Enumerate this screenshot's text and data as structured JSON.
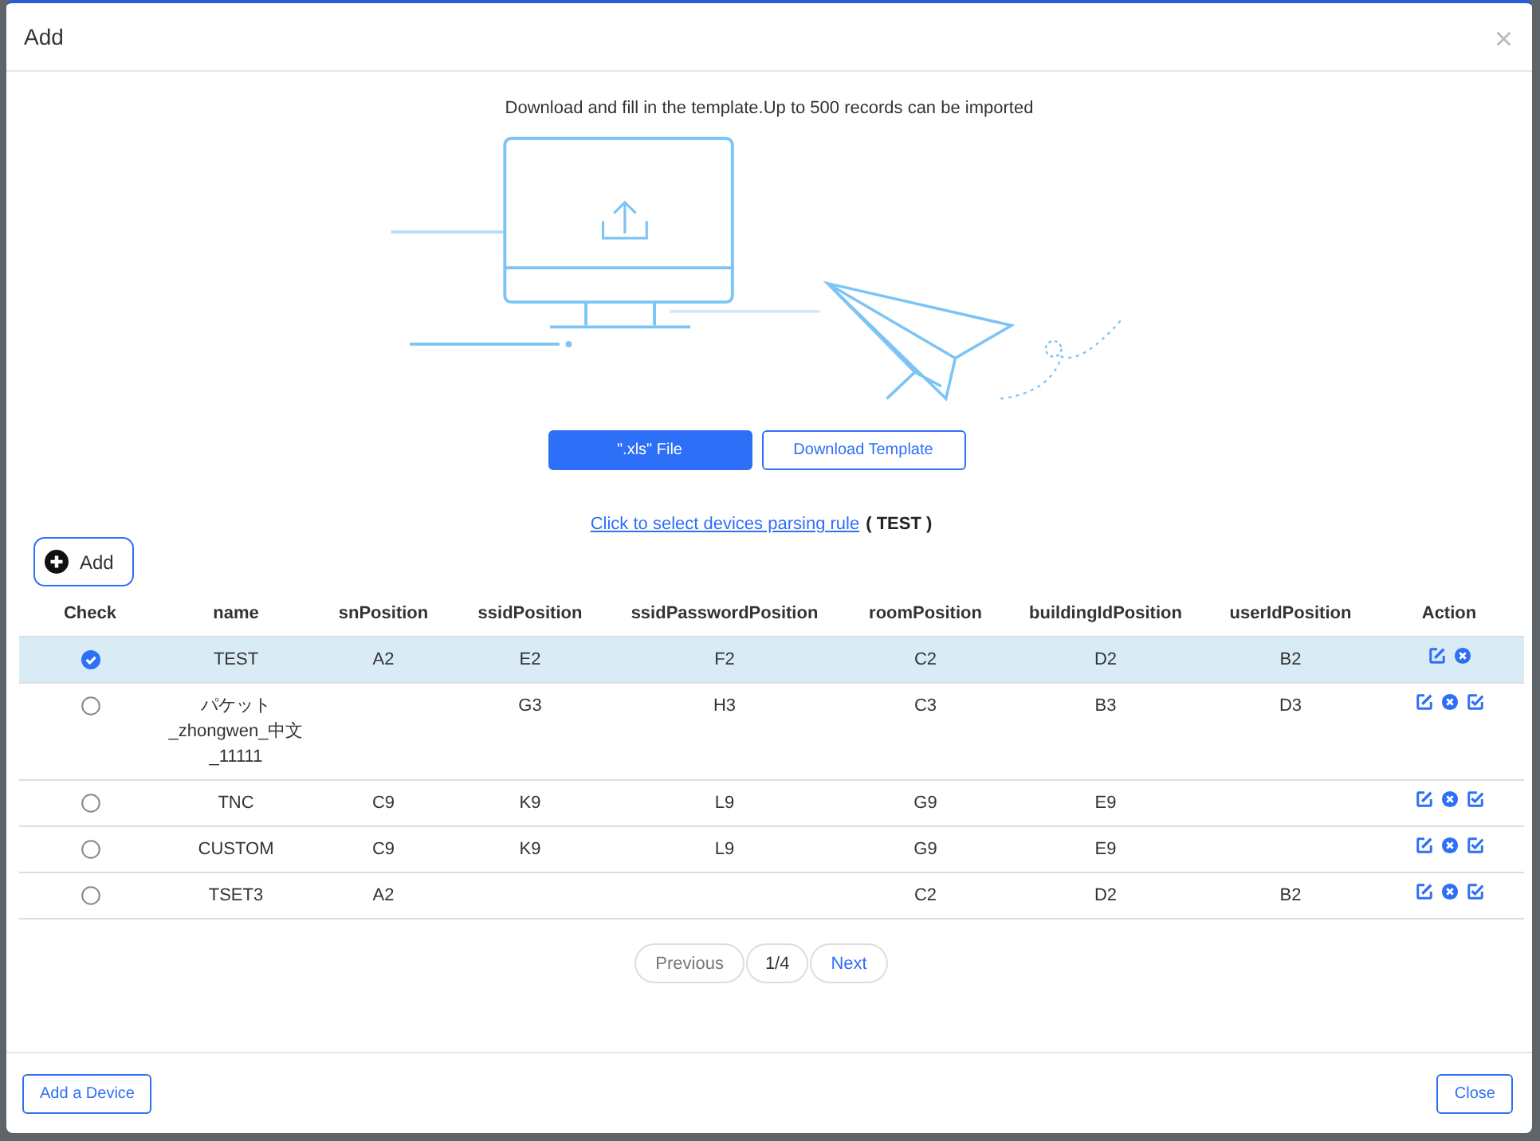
{
  "dialog": {
    "title": "Add",
    "close": "×"
  },
  "intro": "Download and fill in the template.Up to 500 records can be imported",
  "upload_buttons": [
    {
      "label": "\".xls\" File",
      "kind": "primary"
    },
    {
      "label": "Download Template",
      "kind": "outline"
    }
  ],
  "rule": {
    "link": "Click to select devices parsing rule",
    "current": "( TEST )"
  },
  "add_button": "Add",
  "table": {
    "check_header": "Check",
    "action_header": "Action",
    "columns": [
      "name",
      "snPosition",
      "ssidPosition",
      "ssidPasswordPosition",
      "roomPosition",
      "buildingIdPosition",
      "userIdPosition"
    ],
    "rows": [
      {
        "selected": true,
        "cells": [
          "TEST",
          "A2",
          "E2",
          "F2",
          "C2",
          "D2",
          "B2"
        ],
        "actions": [
          {
            "kind": "edit"
          },
          {
            "kind": "delete"
          }
        ]
      },
      {
        "selected": false,
        "cells": [
          "パケット_zhongwen_中文_11111",
          "",
          "G3",
          "H3",
          "C3",
          "B3",
          "D3"
        ],
        "actions": [
          {
            "kind": "edit"
          },
          {
            "kind": "delete"
          },
          {
            "kind": "check"
          }
        ]
      },
      {
        "selected": false,
        "cells": [
          "TNC",
          "C9",
          "K9",
          "L9",
          "G9",
          "E9",
          ""
        ],
        "actions": [
          {
            "kind": "edit"
          },
          {
            "kind": "delete"
          },
          {
            "kind": "check"
          }
        ]
      },
      {
        "selected": false,
        "cells": [
          "CUSTOM",
          "C9",
          "K9",
          "L9",
          "G9",
          "E9",
          ""
        ],
        "actions": [
          {
            "kind": "edit"
          },
          {
            "kind": "delete"
          },
          {
            "kind": "check"
          }
        ]
      },
      {
        "selected": false,
        "cells": [
          "TSET3",
          "A2",
          "",
          "",
          "C2",
          "D2",
          "B2"
        ],
        "actions": [
          {
            "kind": "edit"
          },
          {
            "kind": "delete"
          },
          {
            "kind": "check"
          }
        ]
      }
    ]
  },
  "pagination": [
    {
      "label": "Previous",
      "disabled": true,
      "kind": "nav"
    },
    {
      "label": "1/4",
      "disabled": false,
      "kind": "page"
    },
    {
      "label": "Next",
      "disabled": false,
      "kind": "nav"
    }
  ],
  "footer": {
    "left": "Add a Device",
    "right": "Close"
  }
}
